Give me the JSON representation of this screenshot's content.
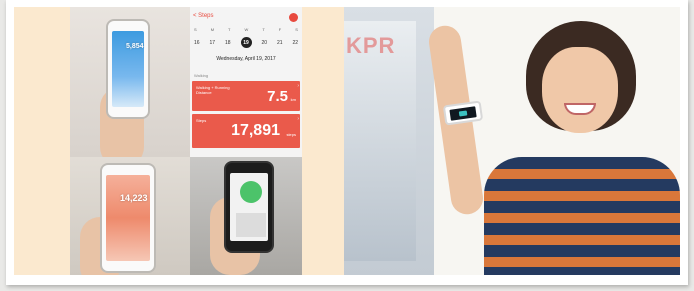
{
  "app_screen": {
    "back_label": "< Steps",
    "weekdays": [
      "S",
      "M",
      "T",
      "W",
      "T",
      "F",
      "S"
    ],
    "dates": [
      "16",
      "17",
      "18",
      "19",
      "20",
      "21",
      "22"
    ],
    "selected_date": "19",
    "date_label": "Wednesday, April 19, 2017",
    "section_label": "Walking",
    "cards": [
      {
        "label": "Walking + Running Distance",
        "value": "7.5",
        "unit": "km"
      },
      {
        "label": "Steps",
        "value": "17,891",
        "unit": "steps"
      }
    ]
  },
  "phone_tl_reading": "5,854",
  "phone_bl_reading": "14,223",
  "poster_lettering": "KPR",
  "colors": {
    "accent": "#ea5a4b",
    "background": "#fbe9cf",
    "watch_accent": "#3cc1c0"
  }
}
